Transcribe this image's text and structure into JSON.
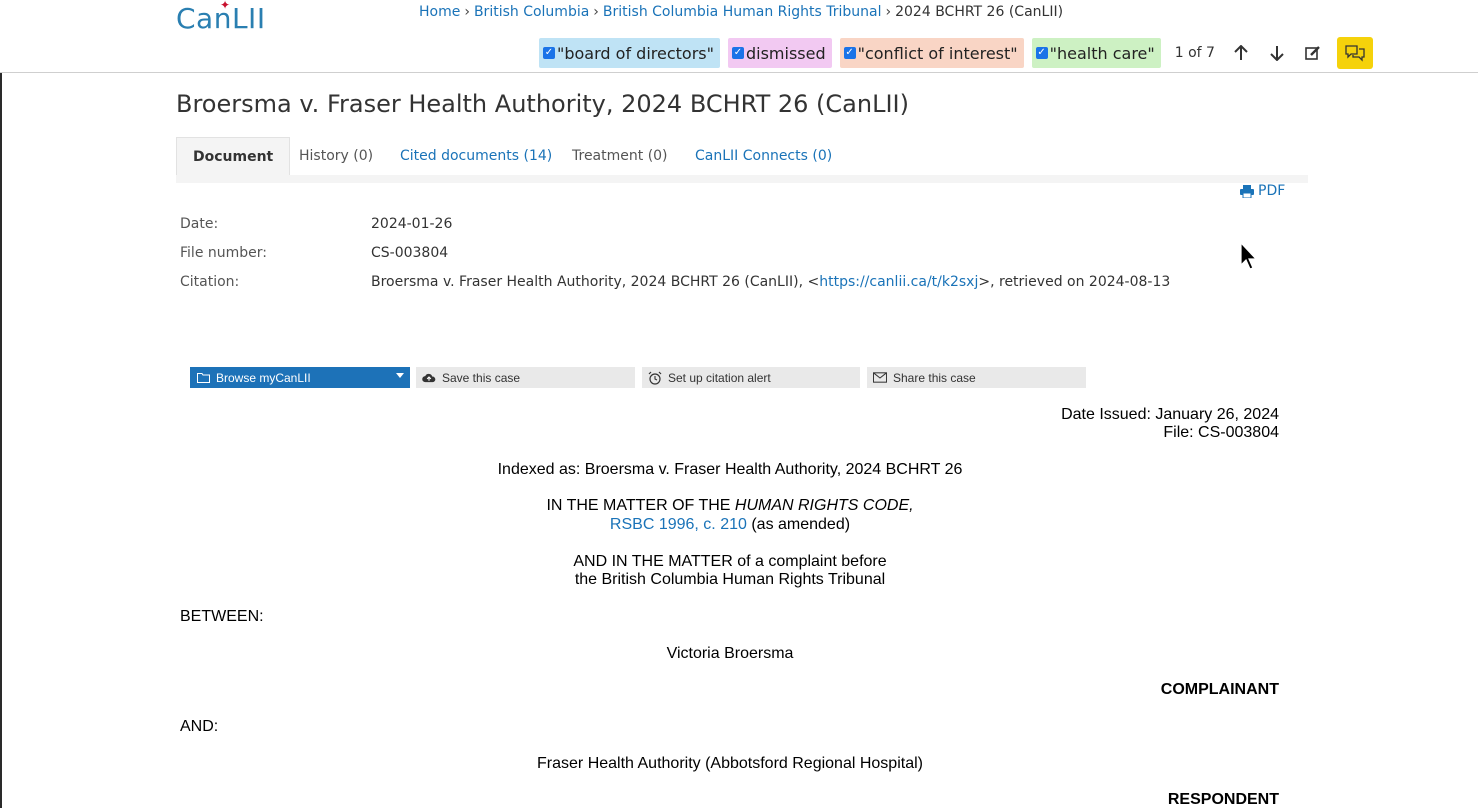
{
  "header": {
    "logo": "CanLII",
    "breadcrumb": [
      {
        "label": "Home"
      },
      {
        "label": "British Columbia"
      },
      {
        "label": "British Columbia Human Rights Tribunal"
      },
      {
        "label": "2024 BCHRT 26 (CanLII)"
      }
    ],
    "search_terms": [
      {
        "label": "\"board of directors\"",
        "color": "#bfe3f5"
      },
      {
        "label": "dismissed",
        "color": "#f2c9f2"
      },
      {
        "label": "\"conflict of interest\"",
        "color": "#f9d5c5"
      },
      {
        "label": "\"health care\"",
        "color": "#cdf1c3"
      }
    ],
    "counter": "1 of 7"
  },
  "page": {
    "title": "Broersma v. Fraser Health Authority, 2024 BCHRT 26 (CanLII)",
    "tabs": [
      {
        "label": "Document"
      },
      {
        "label": "History (0)"
      },
      {
        "label": "Cited documents (14)"
      },
      {
        "label": "Treatment (0)"
      },
      {
        "label": "CanLII Connects (0)"
      }
    ],
    "pdf_label": "PDF"
  },
  "meta": {
    "date_label": "Date:",
    "date_value": "2024-01-26",
    "file_label": "File number:",
    "file_value": "CS-003804",
    "citation_label": "Citation:",
    "citation_prefix": "Broersma v. Fraser Health Authority, 2024 BCHRT 26 (CanLII), <",
    "citation_link": "https://canlii.ca/t/k2sxj",
    "citation_suffix": ">, retrieved on 2024-08-13"
  },
  "tools": {
    "browse": "Browse myCanLII",
    "save": "Save this case",
    "alert": "Set up citation alert",
    "share": "Share this case"
  },
  "document": {
    "date_issued": "Date Issued: January 26, 2024",
    "file": "File: CS-003804",
    "indexed_as": "Indexed as: Broersma v. Fraser Health Authority, 2024 BCHRT 26",
    "matter_1_prefix": "IN THE MATTER OF THE ",
    "matter_1_italic": "HUMAN RIGHTS CODE,",
    "statute_link": "RSBC 1996, c. 210",
    "statute_suffix": " (as amended)",
    "matter_2_line1": "AND IN THE MATTER of a complaint before",
    "matter_2_line2": "the British Columbia Human Rights Tribunal",
    "between": "BETWEEN:",
    "complainant_name": "Victoria Broersma",
    "complainant_role": "COMPLAINANT",
    "and": "AND:",
    "respondent_name": "Fraser Health Authority (Abbotsford Regional Hospital)",
    "respondent_role": "RESPONDENT"
  }
}
